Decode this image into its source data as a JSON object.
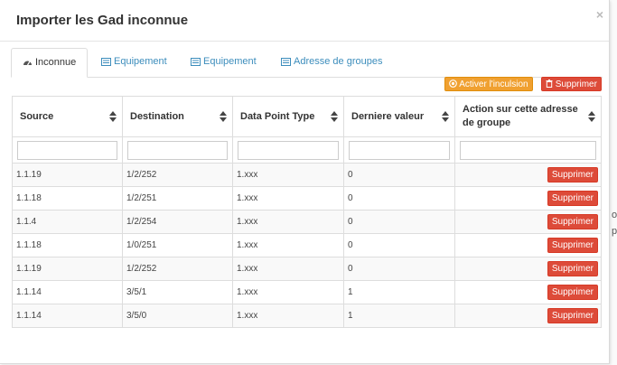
{
  "modal": {
    "title": "Importer les Gad inconnue",
    "close_label": "×"
  },
  "tabs": [
    {
      "label": "Inconnue",
      "icon": "dashboard-icon",
      "active": true
    },
    {
      "label": "Equipement",
      "icon": "list-icon",
      "active": false
    },
    {
      "label": "Equipement",
      "icon": "list-icon",
      "active": false
    },
    {
      "label": "Adresse de groupes",
      "icon": "list-icon",
      "active": false
    }
  ],
  "toolbar": {
    "activate_label": "Activer l'inculsion",
    "delete_label": "Supprimer"
  },
  "table": {
    "columns": [
      "Source",
      "Destination",
      "Data Point Type",
      "Derniere valeur",
      "Action sur cette adresse de groupe"
    ],
    "rows": [
      {
        "source": "1.1.19",
        "destination": "1/2/252",
        "dpt": "1.xxx",
        "value": "0",
        "action": "Supprimer"
      },
      {
        "source": "1.1.18",
        "destination": "1/2/251",
        "dpt": "1.xxx",
        "value": "0",
        "action": "Supprimer"
      },
      {
        "source": "1.1.4",
        "destination": "1/2/254",
        "dpt": "1.xxx",
        "value": "0",
        "action": "Supprimer"
      },
      {
        "source": "1.1.18",
        "destination": "1/0/251",
        "dpt": "1.xxx",
        "value": "0",
        "action": "Supprimer"
      },
      {
        "source": "1.1.19",
        "destination": "1/2/252",
        "dpt": "1.xxx",
        "value": "0",
        "action": "Supprimer"
      },
      {
        "source": "1.1.14",
        "destination": "3/5/1",
        "dpt": "1.xxx",
        "value": "1",
        "action": "Supprimer"
      },
      {
        "source": "1.1.14",
        "destination": "3/5/0",
        "dpt": "1.xxx",
        "value": "1",
        "action": "Supprimer"
      }
    ]
  },
  "background": {
    "glyph_1": "o",
    "glyph_2": "p"
  },
  "colors": {
    "link": "#3c8dbc",
    "warning": "#f0a030",
    "danger": "#dd4b39"
  }
}
